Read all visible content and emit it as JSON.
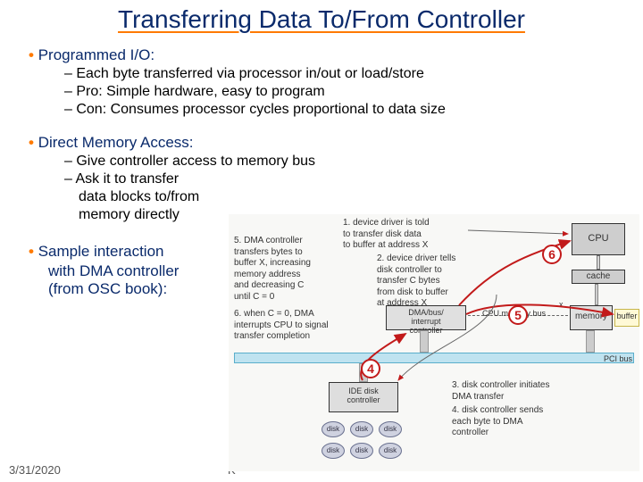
{
  "title": "Transferring Data To/From Controller",
  "bullets": {
    "pio": {
      "head": "Programmed I/O:",
      "sub1": "Each byte transferred via processor in/out or load/store",
      "sub2": "Pro: Simple hardware, easy to program",
      "sub3": "Con: Consumes processor cycles proportional to data size"
    },
    "dma": {
      "head": "Direct Memory Access:",
      "sub1": "Give controller access to memory bus",
      "sub2": "Ask it to transfer",
      "sub3": "data blocks to/from",
      "sub4": "memory directly"
    },
    "sample": {
      "l1": "Sample interaction",
      "l2": "with DMA controller",
      "l3": "(from OSC book):"
    }
  },
  "footer": {
    "date": "3/31/2020",
    "k": "K"
  },
  "dia": {
    "step1": "1. device driver is told\nto transfer disk data\nto buffer at address X",
    "step2": "2. device driver tells\ndisk controller to\ntransfer C bytes\nfrom disk to buffer\nat address X",
    "step3": "3. disk controller initiates\nDMA transfer",
    "step4": "4. disk controller sends\neach byte to DMA\ncontroller",
    "step5": "5. DMA controller\ntransfers bytes to\nbuffer X, increasing\nmemory address\nand decreasing C\nuntil C = 0",
    "step6": "6. when C = 0, DMA\ninterrupts CPU to signal\ntransfer completion",
    "cpu": "CPU",
    "cache": "cache",
    "dmabus": "DMA/bus/\ninterrupt\ncontroller",
    "cpumem": "CPU memory bus",
    "memory": "memory",
    "x": "x",
    "buffer": "buffer",
    "pci": "PCI bus",
    "ide": "IDE disk\ncontroller",
    "disk": "disk",
    "m4": "4",
    "m5": "5",
    "m6": "6"
  }
}
